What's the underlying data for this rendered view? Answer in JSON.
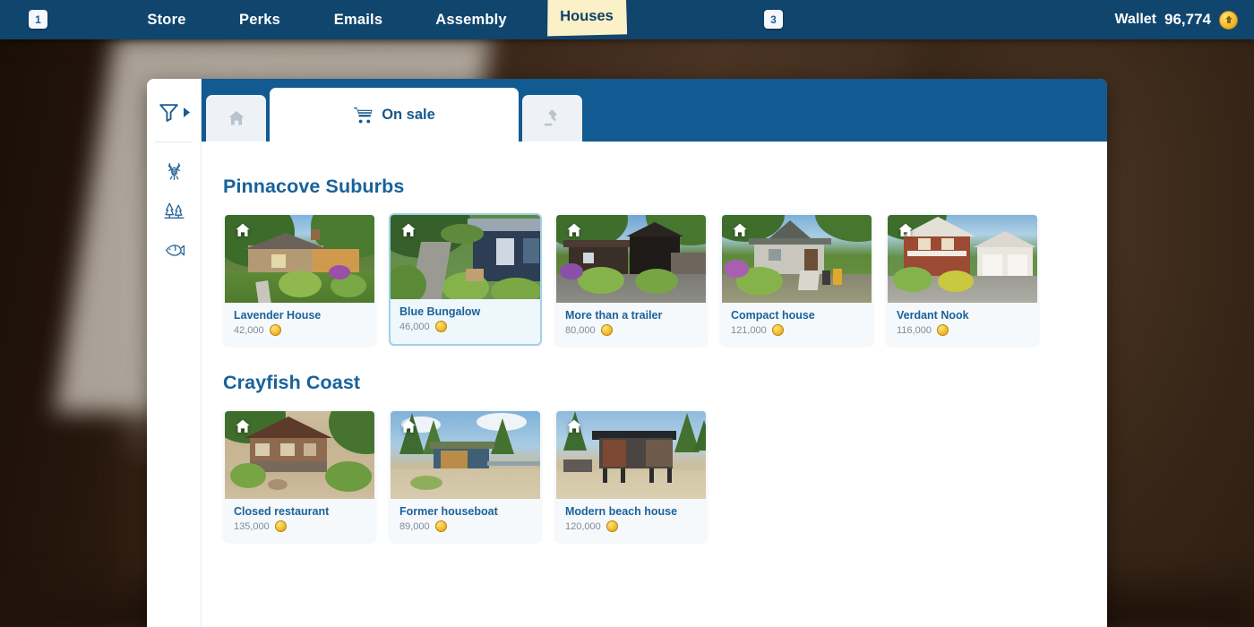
{
  "topbar": {
    "left_badge": "1",
    "mid_badge": "3",
    "items": [
      {
        "label": "Store",
        "name": "nav-store"
      },
      {
        "label": "Perks",
        "name": "nav-perks"
      },
      {
        "label": "Emails",
        "name": "nav-emails"
      },
      {
        "label": "Assembly",
        "name": "nav-assembly"
      }
    ],
    "active_item": "Houses",
    "wallet_label": "Wallet",
    "wallet_amount": "96,774",
    "wallet_icon": "coin-icon",
    "colors": {
      "bar": "#10456e",
      "active_tab": "#faf1c8",
      "active_tab_text": "#103f66"
    }
  },
  "rail": {
    "filter_icon": "filter-funnel-icon",
    "expand_icon": "caret-right-icon",
    "items": [
      {
        "icon": "crayfish-icon",
        "name": "rail-icon-crayfish"
      },
      {
        "icon": "pine-trees-icon",
        "name": "rail-icon-forest"
      },
      {
        "icon": "fish-icon",
        "name": "rail-icon-fish"
      }
    ]
  },
  "tabs": [
    {
      "name": "tab-owned",
      "icon": "home-icon",
      "label": "",
      "active": false
    },
    {
      "name": "tab-on-sale",
      "icon": "shopping-cart-icon",
      "label": "On sale",
      "active": true
    },
    {
      "name": "tab-auction",
      "icon": "gavel-icon",
      "label": "",
      "active": false
    }
  ],
  "sections": [
    {
      "title": "Pinnacove Suburbs",
      "cards": [
        {
          "name": "Lavender House",
          "price": "42,000",
          "selected": false,
          "scene": "lavender"
        },
        {
          "name": "Blue Bungalow",
          "price": "46,000",
          "selected": true,
          "scene": "bungalow"
        },
        {
          "name": "More than a trailer",
          "price": "80,000",
          "selected": false,
          "scene": "trailer"
        },
        {
          "name": "Compact house",
          "price": "121,000",
          "selected": false,
          "scene": "compact"
        },
        {
          "name": "Verdant Nook",
          "price": "116,000",
          "selected": false,
          "scene": "verdant"
        }
      ]
    },
    {
      "title": "Crayfish Coast",
      "cards": [
        {
          "name": "Closed restaurant",
          "price": "135,000",
          "selected": false,
          "scene": "restaurant"
        },
        {
          "name": "Former houseboat",
          "price": "89,000",
          "selected": false,
          "scene": "houseboat"
        },
        {
          "name": "Modern beach house",
          "price": "120,000",
          "selected": false,
          "scene": "beach"
        }
      ]
    }
  ],
  "colors": {
    "panel_bg": "#ffffff",
    "tabstrip": "#115a92",
    "section_title": "#18629b",
    "card_bg": "#f6f9fc",
    "card_selected_border": "#9fd2e8",
    "card_name": "#1b6299",
    "card_price": "#7d8c99",
    "coin": "#f5c23a"
  }
}
